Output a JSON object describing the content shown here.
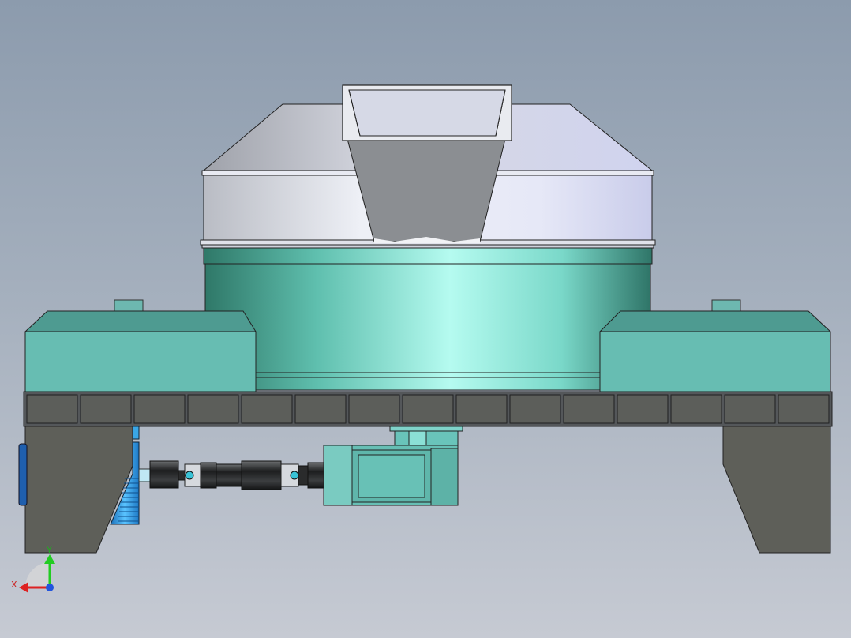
{
  "viewport": {
    "background_top": "#8c9bad",
    "background_bottom": "#c6cad3"
  },
  "model": {
    "hopper_color": "#8a8d90",
    "hood_color": "#d8dbe6",
    "drum_color": "#6cc9bd",
    "housing_color": "#69bfb5",
    "frame_color": "#55575a",
    "leg_color": "#5f605a",
    "motor_color": "#3aa6e6",
    "shaft_color": "#2b2d2e",
    "gearbox_color": "#68c0b5"
  },
  "triad": {
    "y_label": "Y",
    "x_label": "X",
    "y_color": "#22cc22",
    "x_color": "#dd2222",
    "z_color": "#2255dd",
    "icon": "view-orientation-triad-icon"
  }
}
